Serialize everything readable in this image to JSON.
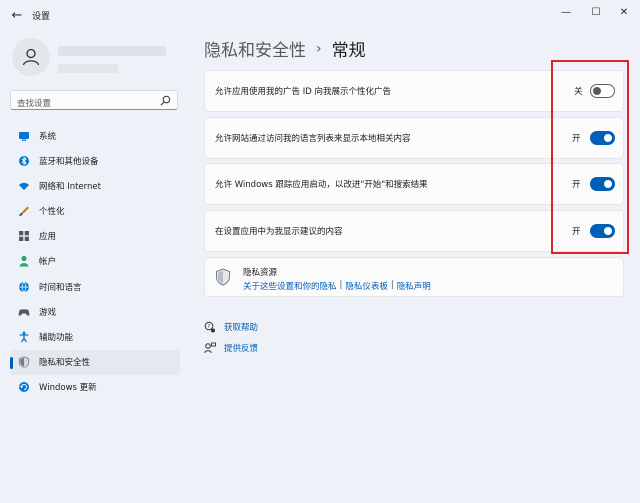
{
  "window": {
    "title": "设置",
    "back_icon": "back-arrow-icon",
    "minimize": "—",
    "maximize": "☐",
    "close": "✕"
  },
  "search": {
    "placeholder": "查找设置"
  },
  "sidebar": {
    "items": [
      {
        "label": "系统",
        "icon": "monitor-icon",
        "color": "#0078d4"
      },
      {
        "label": "蓝牙和其他设备",
        "icon": "bluetooth-icon",
        "color": "#0078d4"
      },
      {
        "label": "网络和 Internet",
        "icon": "wifi-icon",
        "color": "#0078d4"
      },
      {
        "label": "个性化",
        "icon": "brush-icon",
        "color": "#c07a28"
      },
      {
        "label": "应用",
        "icon": "apps-icon",
        "color": "#505a6b"
      },
      {
        "label": "帐户",
        "icon": "person-icon",
        "color": "#2ea36d"
      },
      {
        "label": "时间和语言",
        "icon": "globe-clock-icon",
        "color": "#0078d4"
      },
      {
        "label": "游戏",
        "icon": "gamepad-icon",
        "color": "#505a6b"
      },
      {
        "label": "辅助功能",
        "icon": "accessibility-icon",
        "color": "#0078d4"
      },
      {
        "label": "隐私和安全性",
        "icon": "shield-icon",
        "color": "#707a88",
        "active": true
      },
      {
        "label": "Windows 更新",
        "icon": "update-icon",
        "color": "#0078d4"
      }
    ]
  },
  "page": {
    "breadcrumb_parent": "隐私和安全性",
    "breadcrumb_sep": "›",
    "breadcrumb_current": "常规"
  },
  "settings": [
    {
      "label": "允许应用使用我的广告 ID 向我展示个性化广告",
      "state": "关",
      "on": false
    },
    {
      "label": "允许网站通过访问我的语言列表来显示本地相关内容",
      "state": "开",
      "on": true
    },
    {
      "label": "允许 Windows 跟踪应用启动，以改进\"开始\"和搜索结果",
      "state": "开",
      "on": true
    },
    {
      "label": "在设置应用中为我显示建议的内容",
      "state": "开",
      "on": true
    }
  ],
  "resources": {
    "title": "隐私资源",
    "links": [
      "关于这些设置和你的隐私",
      "隐私仪表板",
      "隐私声明"
    ]
  },
  "help": {
    "get_help": "获取帮助",
    "feedback": "提供反馈"
  },
  "colors": {
    "accent": "#005fb8",
    "highlight": "#e02424"
  }
}
